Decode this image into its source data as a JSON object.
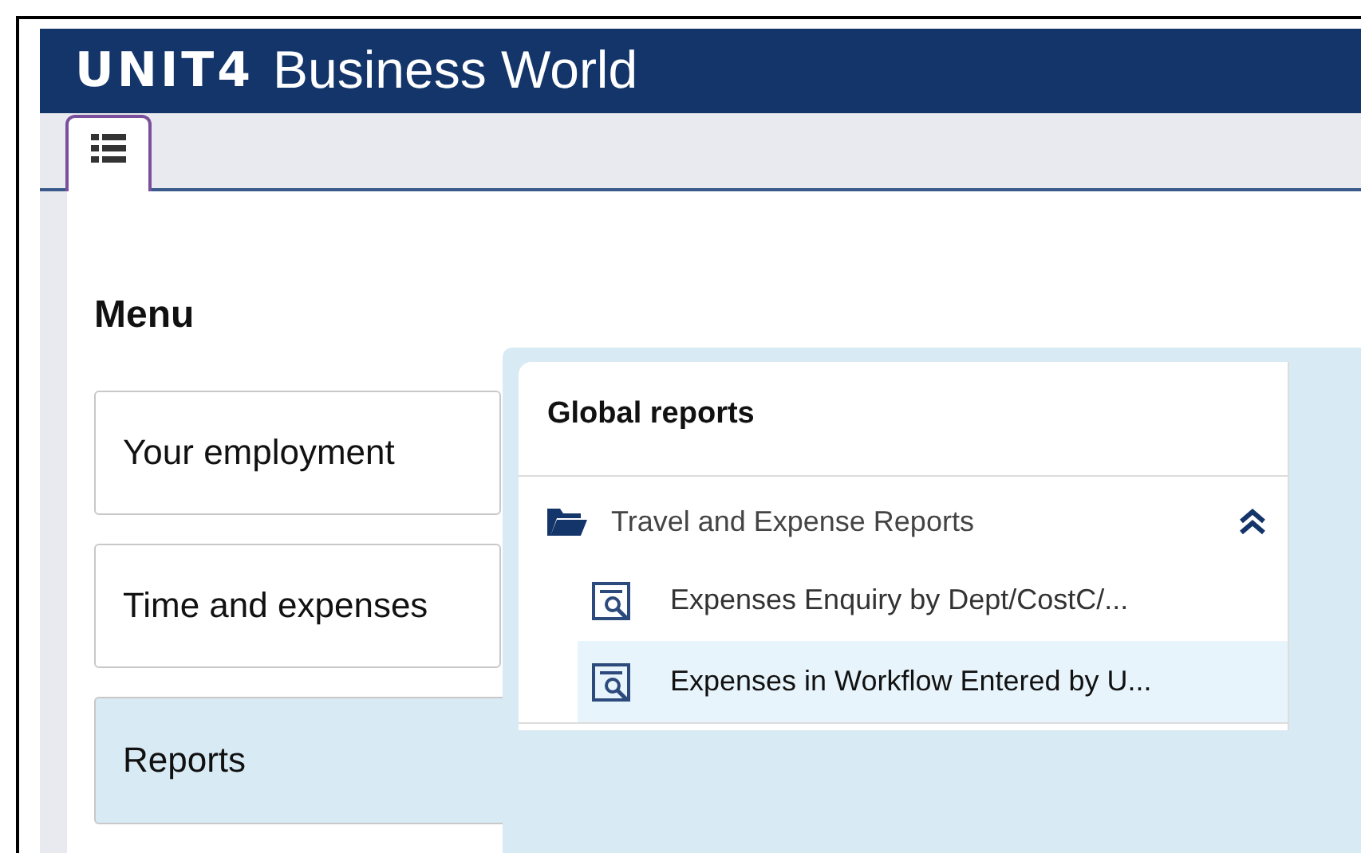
{
  "header": {
    "logo": "UNIT4",
    "title": "Business World"
  },
  "tabs": [
    {
      "kind": "list",
      "selected": true
    }
  ],
  "menu": {
    "title": "Menu",
    "items": [
      {
        "label": "Your employment",
        "selected": false
      },
      {
        "label": "Time and expenses",
        "selected": false
      },
      {
        "label": "Reports",
        "selected": true
      }
    ]
  },
  "flyout": {
    "title": "Global reports",
    "group": {
      "label": "Travel and Expense Reports",
      "expanded": true,
      "items": [
        {
          "label": "Expenses Enquiry by Dept/CostC/...",
          "selected": false
        },
        {
          "label": "Expenses in Workflow Entered by U...",
          "selected": true
        }
      ]
    }
  }
}
